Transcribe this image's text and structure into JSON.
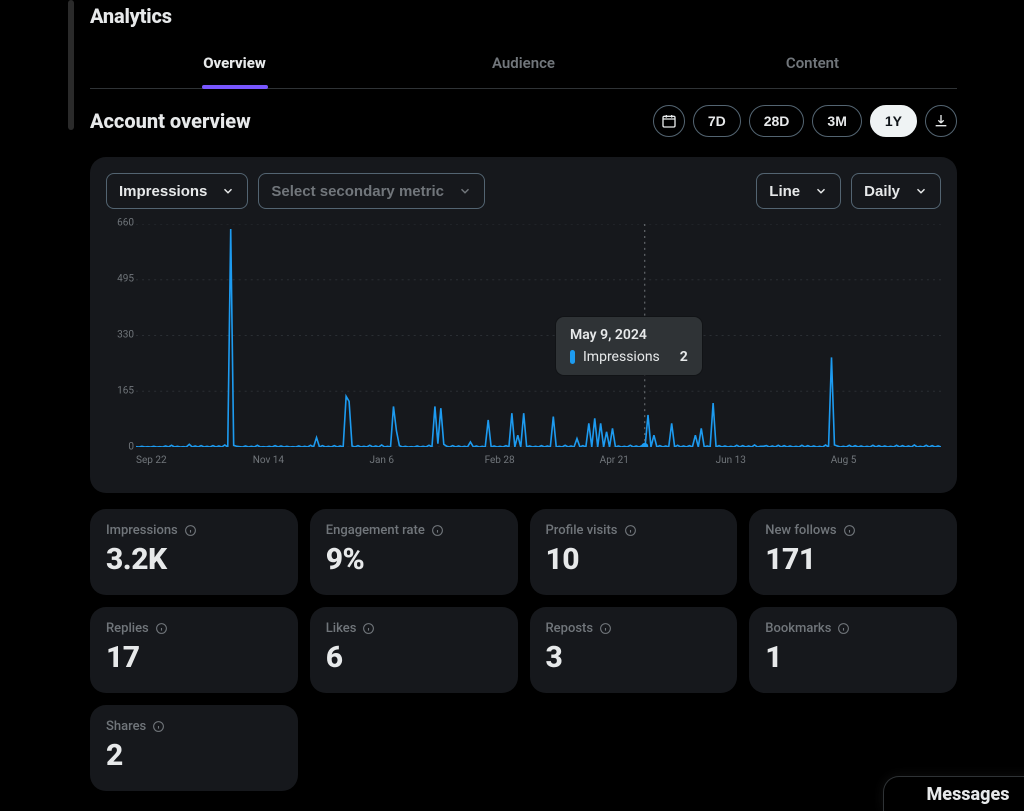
{
  "page": {
    "title": "Analytics",
    "section_title": "Account overview"
  },
  "tabs": {
    "overview": "Overview",
    "audience": "Audience",
    "content": "Content",
    "active": "overview"
  },
  "date_ranges": {
    "r0": "7D",
    "r1": "28D",
    "r2": "3M",
    "r3": "1Y",
    "selected": "1Y"
  },
  "dropdowns": {
    "primary_metric": "Impressions",
    "secondary_metric_placeholder": "Select secondary metric",
    "chart_type": "Line",
    "granularity": "Daily"
  },
  "tooltip": {
    "date": "May 9, 2024",
    "metric": "Impressions",
    "value": "2"
  },
  "cards": {
    "impressions": {
      "label": "Impressions",
      "value": "3.2K"
    },
    "engagement_rate": {
      "label": "Engagement rate",
      "value": "9%"
    },
    "profile_visits": {
      "label": "Profile visits",
      "value": "10"
    },
    "new_follows": {
      "label": "New follows",
      "value": "171"
    },
    "replies": {
      "label": "Replies",
      "value": "17"
    },
    "likes": {
      "label": "Likes",
      "value": "6"
    },
    "reposts": {
      "label": "Reposts",
      "value": "3"
    },
    "bookmarks": {
      "label": "Bookmarks",
      "value": "1"
    },
    "shares": {
      "label": "Shares",
      "value": "2"
    }
  },
  "messages_dock": "Messages",
  "chart_data": {
    "type": "line",
    "title": "Impressions",
    "xlabel": "",
    "ylabel": "",
    "ylim": [
      0,
      660
    ],
    "ytick_labels": [
      "0",
      "165",
      "330",
      "495",
      "660"
    ],
    "xtick_labels": [
      "Sep 22",
      "Nov 14",
      "Jan 6",
      "Feb 28",
      "Apr 21",
      "Jun 13",
      "Aug 5"
    ],
    "xtick_positions_pct": [
      0,
      14.5,
      29.0,
      43.3,
      57.6,
      72.0,
      86.3
    ],
    "hover_x_pct": 63.2,
    "hover_value": 2,
    "series": [
      {
        "name": "Impressions",
        "color": "#1d9bf0",
        "values": [
          1,
          0,
          2,
          0,
          1,
          0,
          2,
          0,
          1,
          0,
          3,
          0,
          5,
          0,
          2,
          0,
          1,
          0,
          8,
          0,
          3,
          0,
          4,
          0,
          2,
          0,
          4,
          0,
          3,
          0,
          6,
          0,
          645,
          5,
          2,
          1,
          0,
          3,
          0,
          2,
          0,
          5,
          0,
          1,
          0,
          2,
          0,
          4,
          0,
          3,
          0,
          2,
          0,
          1,
          0,
          3,
          0,
          2,
          0,
          5,
          0,
          28,
          0,
          4,
          0,
          2,
          0,
          4,
          0,
          3,
          0,
          150,
          135,
          3,
          0,
          4,
          0,
          2,
          0,
          5,
          0,
          3,
          0,
          6,
          0,
          2,
          0,
          120,
          48,
          4,
          0,
          2,
          0,
          1,
          0,
          3,
          0,
          2,
          0,
          5,
          0,
          120,
          10,
          115,
          8,
          2,
          0,
          4,
          0,
          3,
          0,
          2,
          0,
          15,
          0,
          3,
          0,
          2,
          0,
          80,
          0,
          3,
          0,
          2,
          0,
          4,
          0,
          100,
          0,
          35,
          0,
          100,
          0,
          3,
          0,
          2,
          0,
          4,
          0,
          3,
          0,
          90,
          0,
          2,
          0,
          5,
          0,
          3,
          0,
          25,
          0,
          4,
          0,
          70,
          0,
          85,
          0,
          70,
          0,
          45,
          0,
          55,
          0,
          3,
          0,
          2,
          0,
          5,
          0,
          3,
          0,
          4,
          0,
          95,
          0,
          35,
          0,
          4,
          0,
          3,
          0,
          70,
          0,
          5,
          0,
          3,
          0,
          4,
          0,
          35,
          0,
          55,
          0,
          3,
          0,
          130,
          0,
          4,
          0,
          3,
          0,
          2,
          0,
          5,
          0,
          4,
          0,
          3,
          0,
          6,
          0,
          2,
          2,
          4,
          0,
          3,
          0,
          5,
          0,
          4,
          0,
          3,
          0,
          2,
          0,
          5,
          0,
          4,
          0,
          3,
          0,
          2,
          0,
          6,
          0,
          265,
          6,
          3,
          0,
          2,
          0,
          5,
          0,
          4,
          0,
          3,
          0,
          2,
          0,
          5,
          0,
          4,
          0,
          3,
          0,
          2,
          0,
          5,
          0,
          4,
          0,
          3,
          0,
          6,
          0,
          2,
          0,
          5,
          0,
          4,
          0,
          3,
          0
        ]
      }
    ]
  }
}
